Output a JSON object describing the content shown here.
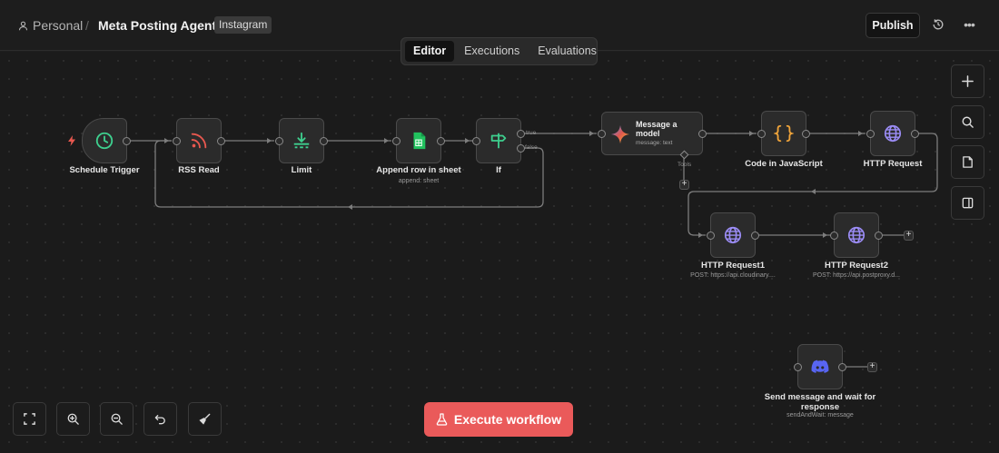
{
  "header": {
    "workspace": "Personal",
    "separator": "/",
    "workflow_title": "Meta Posting Agent",
    "tag": "Instagram",
    "publish_label": "Publish"
  },
  "tabs": [
    {
      "label": "Editor",
      "active": true
    },
    {
      "label": "Executions",
      "active": false
    },
    {
      "label": "Evaluations",
      "active": false
    }
  ],
  "nodes": {
    "schedule": {
      "label": "Schedule Trigger",
      "icon": "clock-icon"
    },
    "rss": {
      "label": "RSS Read",
      "icon": "rss-icon"
    },
    "limit": {
      "label": "Limit",
      "icon": "limit-icon"
    },
    "sheet": {
      "label": "Append row in sheet",
      "sub": "append: sheet",
      "icon": "sheets-icon"
    },
    "if": {
      "label": "If",
      "icon": "signpost-icon",
      "true_label": "true",
      "false_label": "false"
    },
    "model": {
      "label": "Message a model",
      "sub": "message: text",
      "tools_label": "Tools",
      "icon": "gemini-icon"
    },
    "code": {
      "label": "Code in JavaScript",
      "icon": "braces-icon"
    },
    "http": {
      "label": "HTTP Request",
      "icon": "globe-icon"
    },
    "http1": {
      "label": "HTTP Request1",
      "sub": "POST: https://api.cloudinary....",
      "icon": "globe-icon"
    },
    "http2": {
      "label": "HTTP Request2",
      "sub": "POST: https://api.postproxy.d...",
      "icon": "globe-icon"
    },
    "discord": {
      "label": "Send message and wait for response",
      "sub": "sendAndWait: message",
      "icon": "discord-icon"
    }
  },
  "execute_label": "Execute workflow",
  "colors": {
    "accent": "#ea5a5a",
    "trigger_green": "#3ecf8e",
    "rss_red": "#e8584f",
    "sheets_green": "#21c25e",
    "code_orange": "#f0a43a",
    "globe_purple": "#9b8cf5",
    "discord_blue": "#5865f2"
  }
}
